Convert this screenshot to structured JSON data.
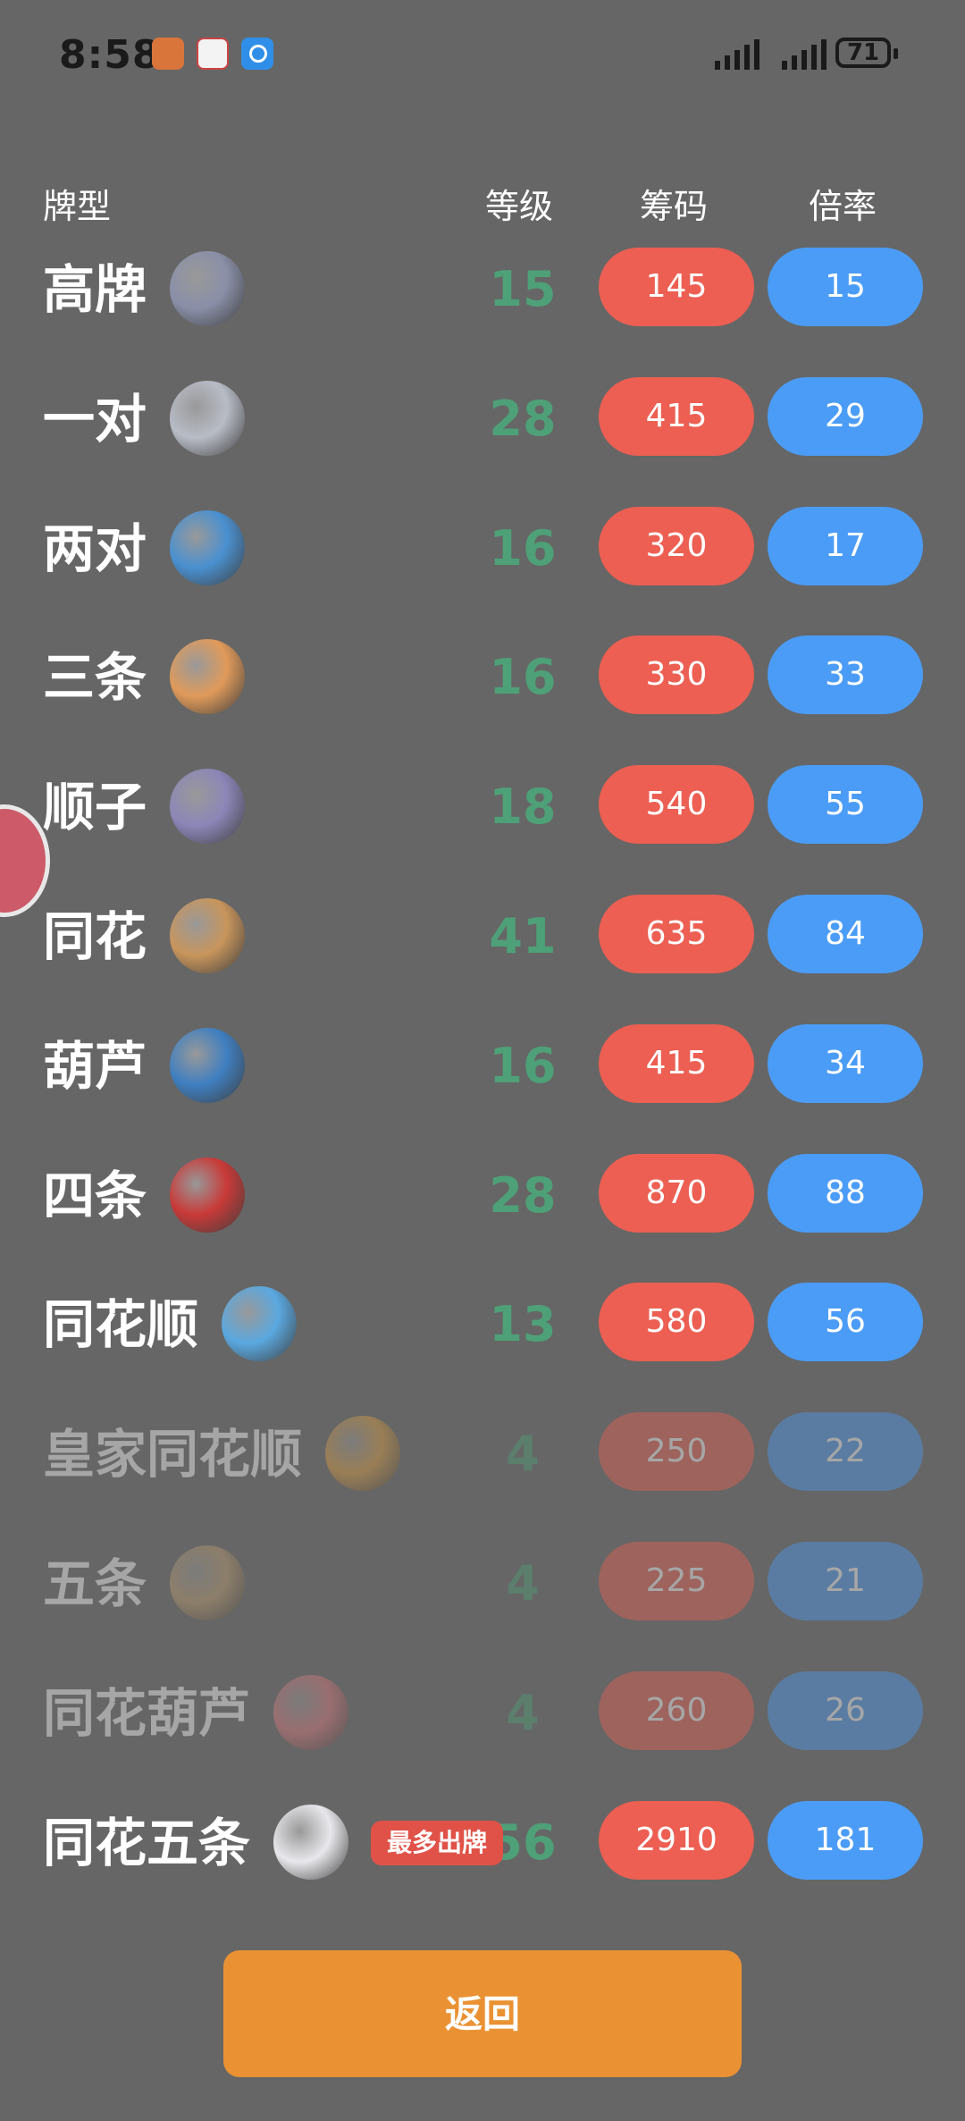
{
  "status_bar": {
    "time": "8:58",
    "battery": "71"
  },
  "header": {
    "type": "牌型",
    "level": "等级",
    "chips": "筹码",
    "mult": "倍率"
  },
  "rows": [
    {
      "name": "高牌",
      "level": "15",
      "chips": "145",
      "mult": "15",
      "planet": "silver-planet-icon",
      "color": "#8a8fa8"
    },
    {
      "name": "一对",
      "level": "28",
      "chips": "415",
      "mult": "29",
      "planet": "moon-planet-icon",
      "color": "#b8bcc6"
    },
    {
      "name": "两对",
      "level": "16",
      "chips": "320",
      "mult": "17",
      "planet": "blue-ringed-planet-icon",
      "color": "#4a90d0"
    },
    {
      "name": "三条",
      "level": "16",
      "chips": "330",
      "mult": "33",
      "planet": "orange-planet-icon",
      "color": "#e09a5a"
    },
    {
      "name": "顺子",
      "level": "18",
      "chips": "540",
      "mult": "55",
      "planet": "purple-ringed-planet-icon",
      "color": "#8c86b8"
    },
    {
      "name": "同花",
      "level": "41",
      "chips": "635",
      "mult": "84",
      "planet": "jupiter-planet-icon",
      "color": "#c8955c"
    },
    {
      "name": "葫芦",
      "level": "16",
      "chips": "415",
      "mult": "34",
      "planet": "earth-planet-icon",
      "color": "#3f7fc0"
    },
    {
      "name": "四条",
      "level": "28",
      "chips": "870",
      "mult": "88",
      "planet": "red-planet-icon",
      "color": "#c83a38"
    },
    {
      "name": "同花顺",
      "level": "13",
      "chips": "580",
      "mult": "56",
      "planet": "neptune-planet-icon",
      "color": "#5aa8e0"
    },
    {
      "name": "皇家同花顺",
      "level": "4",
      "chips": "250",
      "mult": "22",
      "planet": "gold-planet-icon",
      "color": "#e0a040"
    },
    {
      "name": "五条",
      "level": "4",
      "chips": "225",
      "mult": "21",
      "planet": "crater-planet-icon",
      "color": "#c2a070"
    },
    {
      "name": "同花葫芦",
      "level": "4",
      "chips": "260",
      "mult": "26",
      "planet": "pink-planet-icon",
      "color": "#e07a80"
    },
    {
      "name": "同花五条",
      "level": "56",
      "chips": "2910",
      "mult": "181",
      "planet": "black-hole-icon",
      "color": "#e8e8ec",
      "badge": "最多出牌"
    }
  ],
  "back_button": "返回"
}
